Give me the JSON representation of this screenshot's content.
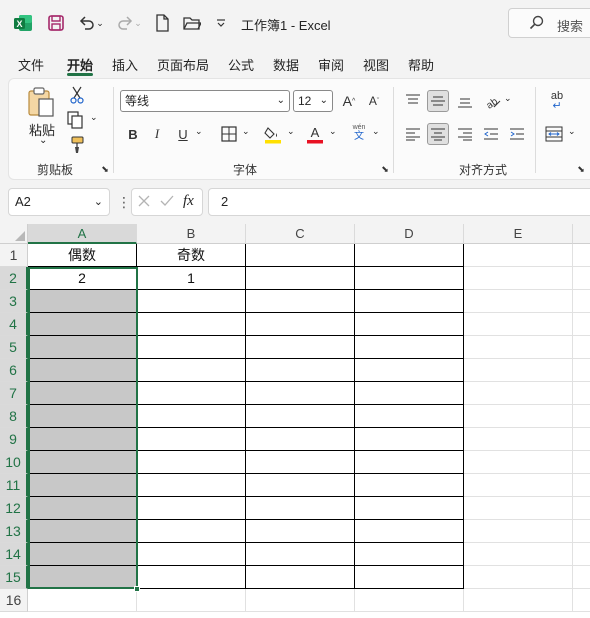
{
  "titlebar": {
    "app_icon": "excel-logo-icon",
    "title": "工作簿1  -  Excel",
    "search_label": "搜索"
  },
  "menu": [
    "文件",
    "开始",
    "插入",
    "页面布局",
    "公式",
    "数据",
    "审阅",
    "视图",
    "帮助"
  ],
  "active_menu": "开始",
  "ribbon": {
    "clipboard": {
      "label": "剪贴板",
      "paste": "粘贴"
    },
    "font": {
      "label": "字体",
      "name": "等线",
      "size": "12",
      "bold": "B",
      "italic": "I",
      "underline": "U",
      "wen": "wén",
      "wen_char": "文"
    },
    "align": {
      "label": "对齐方式",
      "wrap": "ab"
    }
  },
  "formula": {
    "name_box": "A2",
    "fx": "fx",
    "value": "2"
  },
  "columns": [
    "A",
    "B",
    "C",
    "D",
    "E"
  ],
  "rows": [
    "1",
    "2",
    "3",
    "4",
    "5",
    "6",
    "7",
    "8",
    "9",
    "10",
    "11",
    "12",
    "13",
    "14",
    "15",
    "16"
  ],
  "cells": {
    "A1": "偶数",
    "B1": "奇数",
    "A2": "2",
    "B2": "1"
  },
  "selection": {
    "active_cell": "A2",
    "range": "A2:A15"
  },
  "colors": {
    "accent": "#217346",
    "selection_fill": "#c8c8c8"
  }
}
